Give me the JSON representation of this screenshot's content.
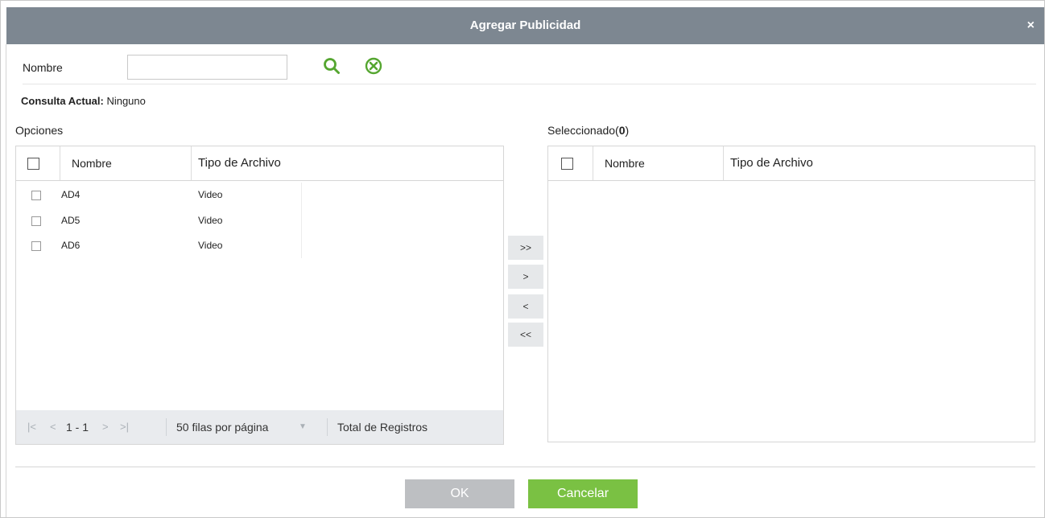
{
  "dialog": {
    "title": "Agregar Publicidad",
    "close_glyph": "×"
  },
  "search": {
    "label": "Nombre",
    "value": "",
    "placeholder": "",
    "search_icon": "search-icon",
    "clear_icon": "clear-icon"
  },
  "current_query": {
    "label": "Consulta Actual:",
    "value": "Ninguno"
  },
  "options": {
    "label": "Opciones",
    "columns": {
      "name": "Nombre",
      "file_type": "Tipo de Archivo"
    },
    "rows": [
      {
        "name": "AD4",
        "file_type": "Video"
      },
      {
        "name": "AD5",
        "file_type": "Video"
      },
      {
        "name": "AD6",
        "file_type": "Video"
      }
    ],
    "pager": {
      "range": "1 - 1",
      "rows_per_page": "50 filas por página",
      "total_label": "Total de Registros"
    }
  },
  "selected": {
    "label_prefix": "Seleccionado(",
    "count": "0",
    "label_suffix": ")",
    "columns": {
      "name": "Nombre",
      "file_type": "Tipo de Archivo"
    }
  },
  "transfer": {
    "add_all": ">>",
    "add": ">",
    "remove": "<",
    "remove_all": "<<"
  },
  "footer": {
    "ok": "OK",
    "cancel": "Cancelar"
  },
  "colors": {
    "titlebar": "#7d8791",
    "accent_green": "#7ac143",
    "icon_green": "#55a630",
    "ok_disabled": "#bdbfc2",
    "pager_bg": "#e9ebee"
  }
}
